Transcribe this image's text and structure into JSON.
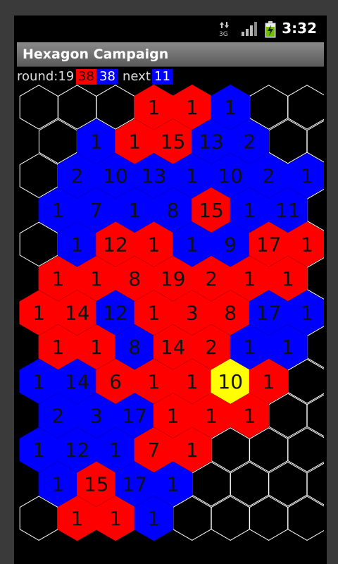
{
  "status_bar": {
    "network": "3G",
    "time": "3:32"
  },
  "title_bar": {
    "title": "Hexagon Campaign"
  },
  "info_bar": {
    "round_label": "round:19",
    "red_count": "38",
    "blue_count": "38",
    "next_label": "next:",
    "next_value": "11"
  },
  "colors": {
    "red": "#ff0000",
    "blue": "#0000ff",
    "yellow": "#ffff00",
    "empty_outline": "#ffffff",
    "background": "#000000"
  },
  "board": {
    "rows": [
      [
        [
          "E",
          ""
        ],
        [
          "E",
          ""
        ],
        [
          "E",
          ""
        ],
        [
          "R",
          "1"
        ],
        [
          "R",
          "1"
        ],
        [
          "B",
          "1"
        ],
        [
          "E",
          ""
        ],
        [
          "E",
          ""
        ]
      ],
      [
        [
          "E",
          ""
        ],
        [
          "B",
          "1"
        ],
        [
          "R",
          "1"
        ],
        [
          "R",
          "15"
        ],
        [
          "B",
          "13"
        ],
        [
          "B",
          "2"
        ],
        [
          "E",
          ""
        ],
        [
          "E",
          ""
        ]
      ],
      [
        [
          "E",
          ""
        ],
        [
          "B",
          "2"
        ],
        [
          "B",
          "10"
        ],
        [
          "B",
          "13"
        ],
        [
          "B",
          "1"
        ],
        [
          "B",
          "10"
        ],
        [
          "B",
          "2"
        ],
        [
          "B",
          "1"
        ]
      ],
      [
        [
          "B",
          "1"
        ],
        [
          "B",
          "7"
        ],
        [
          "B",
          "1"
        ],
        [
          "B",
          "8"
        ],
        [
          "R",
          "15"
        ],
        [
          "B",
          "1"
        ],
        [
          "B",
          "11"
        ],
        [
          "E",
          ""
        ]
      ],
      [
        [
          "E",
          ""
        ],
        [
          "B",
          "1"
        ],
        [
          "R",
          "12"
        ],
        [
          "R",
          "1"
        ],
        [
          "B",
          "1"
        ],
        [
          "B",
          "9"
        ],
        [
          "R",
          "17"
        ],
        [
          "R",
          "1"
        ]
      ],
      [
        [
          "R",
          "1"
        ],
        [
          "R",
          "1"
        ],
        [
          "R",
          "8"
        ],
        [
          "R",
          "19"
        ],
        [
          "R",
          "2"
        ],
        [
          "R",
          "1"
        ],
        [
          "R",
          "1"
        ],
        [
          "E",
          ""
        ]
      ],
      [
        [
          "R",
          "1"
        ],
        [
          "R",
          "14"
        ],
        [
          "B",
          "12"
        ],
        [
          "R",
          "1"
        ],
        [
          "R",
          "3"
        ],
        [
          "R",
          "8"
        ],
        [
          "B",
          "17"
        ],
        [
          "B",
          "1"
        ]
      ],
      [
        [
          "R",
          "1"
        ],
        [
          "R",
          "1"
        ],
        [
          "B",
          "8"
        ],
        [
          "R",
          "14"
        ],
        [
          "R",
          "2"
        ],
        [
          "B",
          "1"
        ],
        [
          "B",
          "1"
        ],
        [
          "E",
          ""
        ]
      ],
      [
        [
          "B",
          "1"
        ],
        [
          "B",
          "14"
        ],
        [
          "R",
          "6"
        ],
        [
          "R",
          "1"
        ],
        [
          "R",
          "1"
        ],
        [
          "Y",
          "10"
        ],
        [
          "R",
          "1"
        ],
        [
          "E",
          ""
        ]
      ],
      [
        [
          "B",
          "2"
        ],
        [
          "B",
          "3"
        ],
        [
          "B",
          "17"
        ],
        [
          "R",
          "1"
        ],
        [
          "R",
          "1"
        ],
        [
          "R",
          "1"
        ],
        [
          "E",
          ""
        ],
        [
          "E",
          ""
        ]
      ],
      [
        [
          "B",
          "1"
        ],
        [
          "B",
          "12"
        ],
        [
          "B",
          "1"
        ],
        [
          "R",
          "7"
        ],
        [
          "R",
          "1"
        ],
        [
          "E",
          ""
        ],
        [
          "E",
          ""
        ],
        [
          "E",
          ""
        ]
      ],
      [
        [
          "B",
          "1"
        ],
        [
          "R",
          "15"
        ],
        [
          "B",
          "17"
        ],
        [
          "B",
          "1"
        ],
        [
          "E",
          ""
        ],
        [
          "E",
          ""
        ],
        [
          "E",
          ""
        ],
        [
          "E",
          ""
        ]
      ],
      [
        [
          "E",
          ""
        ],
        [
          "R",
          "1"
        ],
        [
          "R",
          "1"
        ],
        [
          "B",
          "1"
        ],
        [
          "E",
          ""
        ],
        [
          "E",
          ""
        ],
        [
          "E",
          ""
        ],
        [
          "E",
          ""
        ]
      ]
    ]
  }
}
